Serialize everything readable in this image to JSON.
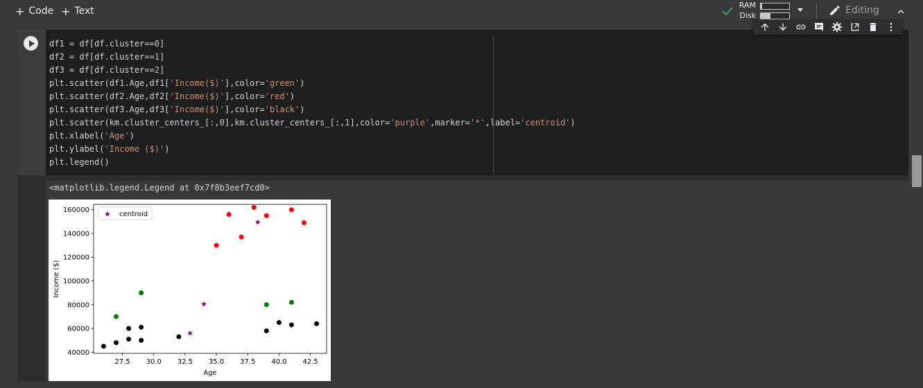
{
  "toolbar": {
    "code_label": "Code",
    "text_label": "Text",
    "ram_label": "RAM",
    "disk_label": "Disk",
    "ram_fill": 0.04,
    "disk_fill": 0.35,
    "editing_label": "Editing"
  },
  "cell": {
    "code_lines": [
      [
        [
          "df1 = df[df.cluster==",
          ""
        ],
        [
          "0",
          "n"
        ],
        [
          "]",
          ""
        ]
      ],
      [
        [
          "df2 = df[df.cluster==",
          ""
        ],
        [
          "1",
          "n"
        ],
        [
          "]",
          ""
        ]
      ],
      [
        [
          "df3 = df[df.cluster==",
          ""
        ],
        [
          "2",
          "n"
        ],
        [
          "]",
          ""
        ]
      ],
      [
        [
          "plt.scatter(df1.Age,df1[",
          ""
        ],
        [
          "'Income($)'",
          "s"
        ],
        [
          "],color=",
          ""
        ],
        [
          "'green'",
          "s"
        ],
        [
          ")",
          ""
        ]
      ],
      [
        [
          "plt.scatter(df2.Age,df2[",
          ""
        ],
        [
          "'Income($)'",
          "s"
        ],
        [
          "],color=",
          ""
        ],
        [
          "'red'",
          "s"
        ],
        [
          ")",
          ""
        ]
      ],
      [
        [
          "plt.scatter(df3.Age,df3[",
          ""
        ],
        [
          "'Income($)'",
          "s"
        ],
        [
          "],color=",
          ""
        ],
        [
          "'black'",
          "s"
        ],
        [
          ")",
          ""
        ]
      ],
      [
        [
          "plt.scatter(km.cluster_centers_[:,",
          ""
        ],
        [
          "0",
          "n"
        ],
        [
          "],km.cluster_centers_[:,",
          ""
        ],
        [
          "1",
          "n"
        ],
        [
          "],color=",
          ""
        ],
        [
          "'purple'",
          "s"
        ],
        [
          ",marker=",
          ""
        ],
        [
          "'*'",
          "s"
        ],
        [
          ",label=",
          ""
        ],
        [
          "'centroid'",
          "s"
        ],
        [
          ")",
          ""
        ]
      ],
      [
        [
          "plt.xlabel(",
          ""
        ],
        [
          "'Age'",
          "s"
        ],
        [
          ")",
          ""
        ]
      ],
      [
        [
          "plt.ylabel(",
          ""
        ],
        [
          "'Income ($)'",
          "s"
        ],
        [
          ")",
          ""
        ]
      ],
      [
        [
          "plt.legend()",
          ""
        ]
      ]
    ],
    "output_text": "<matplotlib.legend.Legend at 0x7f8b3eef7cd0>"
  },
  "chart_data": {
    "type": "scatter",
    "xlabel": "Age",
    "ylabel": "Income ($)",
    "xlim": [
      25.2,
      43.8
    ],
    "ylim": [
      39000,
      164500
    ],
    "xticks": [
      27.5,
      30.0,
      32.5,
      35.0,
      37.5,
      40.0,
      42.5
    ],
    "xtick_labels": [
      "27.5",
      "30.0",
      "32.5",
      "35.0",
      "37.5",
      "40.0",
      "42.5"
    ],
    "yticks": [
      40000,
      60000,
      80000,
      100000,
      120000,
      140000,
      160000
    ],
    "ytick_labels": [
      "40000",
      "60000",
      "80000",
      "100000",
      "120000",
      "140000",
      "160000"
    ],
    "legend_position": "top-left",
    "series": [
      {
        "color": "#008000",
        "marker": "circle",
        "x": [
          27,
          29,
          39,
          41
        ],
        "y": [
          70000,
          90000,
          80000,
          82000
        ]
      },
      {
        "color": "#ff0000",
        "marker": "circle",
        "x": [
          35,
          36,
          37,
          38,
          39,
          41,
          42
        ],
        "y": [
          130000,
          156000,
          137000,
          162000,
          155000,
          160000,
          149000
        ]
      },
      {
        "color": "#000000",
        "marker": "circle",
        "x": [
          26,
          27,
          28,
          28,
          29,
          29,
          32,
          39,
          40,
          41,
          43
        ],
        "y": [
          45000,
          48000,
          51000,
          60000,
          50000,
          61000,
          53000,
          58000,
          65000,
          63000,
          64000
        ]
      },
      {
        "name": "centroid",
        "color": "#800080",
        "marker": "star",
        "x": [
          32.9,
          34.0,
          38.3
        ],
        "y": [
          56000,
          80500,
          149500
        ]
      }
    ]
  }
}
